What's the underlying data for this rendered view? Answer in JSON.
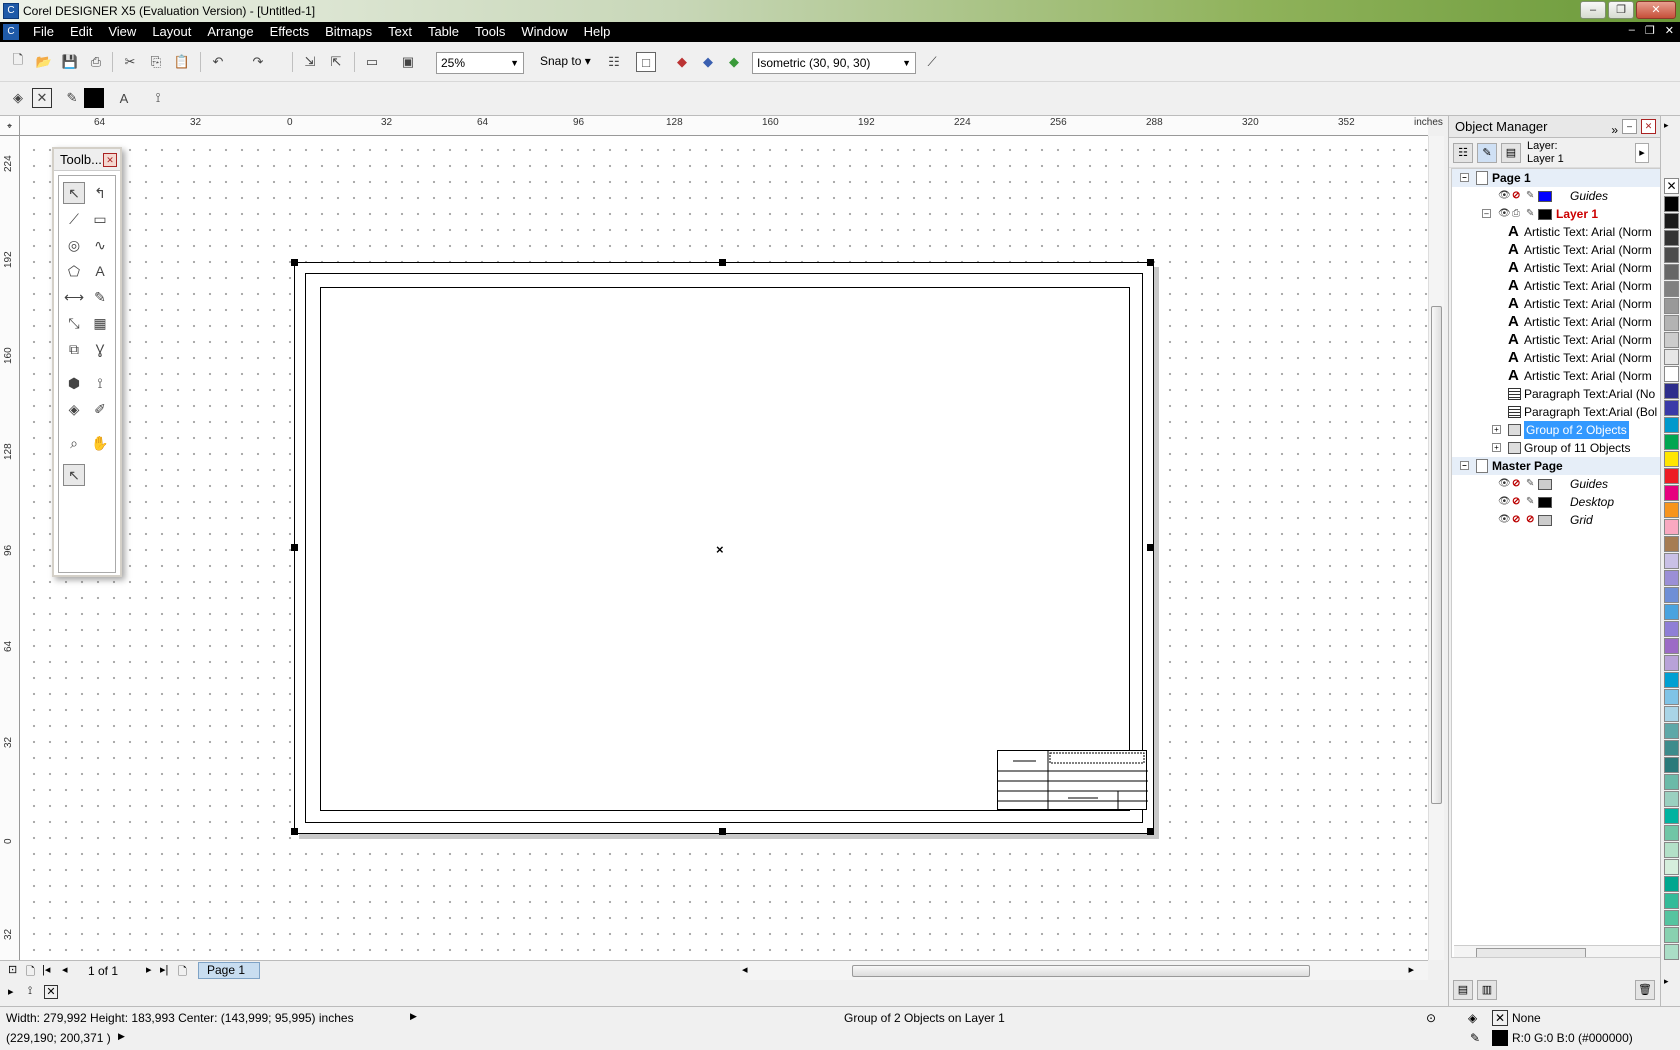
{
  "window": {
    "title": "Corel DESIGNER X5 (Evaluation Version) - [Untitled-1]"
  },
  "menu": [
    "File",
    "Edit",
    "View",
    "Layout",
    "Arrange",
    "Effects",
    "Bitmaps",
    "Text",
    "Table",
    "Tools",
    "Window",
    "Help"
  ],
  "toolbar": {
    "zoom": "25%",
    "snap_label": "Snap to",
    "projection": "Isometric (30, 90, 30)"
  },
  "ruler": {
    "top_labels": [
      "64",
      "32",
      "0",
      "32",
      "64",
      "96",
      "128",
      "160",
      "192",
      "224",
      "256",
      "288",
      "320",
      "352"
    ],
    "unit": "inches",
    "left_labels": [
      "224",
      "192",
      "160",
      "128",
      "96",
      "64",
      "32",
      "0",
      "32"
    ]
  },
  "toolbox": {
    "title": "Toolb..."
  },
  "object_manager": {
    "title": "Object Manager",
    "layer_label": "Layer:",
    "layer_name": "Layer 1",
    "tree": {
      "page1": "Page 1",
      "guides": "Guides",
      "layer1": "Layer 1",
      "artistic": [
        "Artistic Text: Arial (Norm",
        "Artistic Text: Arial (Norm",
        "Artistic Text: Arial (Norm",
        "Artistic Text: Arial (Norm",
        "Artistic Text: Arial (Norm",
        "Artistic Text: Arial (Norm",
        "Artistic Text: Arial (Norm",
        "Artistic Text: Arial (Norm",
        "Artistic Text: Arial (Norm"
      ],
      "para1": "Paragraph Text:Arial (No",
      "para2": "Paragraph Text:Arial (Bol",
      "group2": "Group of 2 Objects",
      "group11": "Group of 11 Objects",
      "master": "Master Page",
      "m_guides": "Guides",
      "m_desktop": "Desktop",
      "m_grid": "Grid"
    }
  },
  "page_nav": {
    "count": "1 of 1",
    "tab": "Page 1"
  },
  "status": {
    "dimensions": "Width: 279,992  Height: 183,993  Center: (143,999; 95,995)  inches",
    "coords": "(229,190; 200,371 )",
    "selection": "Group of 2 Objects on Layer 1",
    "fill": "None",
    "outline": "R:0 G:0 B:0 (#000000)"
  },
  "colors": {
    "guides_swatch": "#0000ff",
    "layer_swatch": "#000000",
    "palette": [
      "#000000",
      "#1a1a1a",
      "#333333",
      "#4d4d4d",
      "#666666",
      "#808080",
      "#999999",
      "#b3b3b3",
      "#cccccc",
      "#e6e6e6",
      "#ffffff",
      "#2e2e8c",
      "#3a3aa8",
      "#0099cc",
      "#00a651",
      "#ffe600",
      "#ed1c24",
      "#e6007e",
      "#f7941d",
      "#f9a8c0",
      "#a67c52",
      "#c9c0e6",
      "#9b8fd6",
      "#6f8fd6",
      "#4aa3df",
      "#8f7fd6",
      "#9c6bc6",
      "#b8a2d8",
      "#00a0d2",
      "#7fc3e6",
      "#a9d4e6",
      "#5ea8a8",
      "#3c8c8c",
      "#2a7a7a",
      "#6bbaa8",
      "#9ad0c0",
      "#00b3a0",
      "#70c6a6",
      "#b3e0c8",
      "#d5eedc",
      "#00a78f",
      "#33bb99",
      "#55c4a0",
      "#88d1b0",
      "#aadec6"
    ]
  }
}
